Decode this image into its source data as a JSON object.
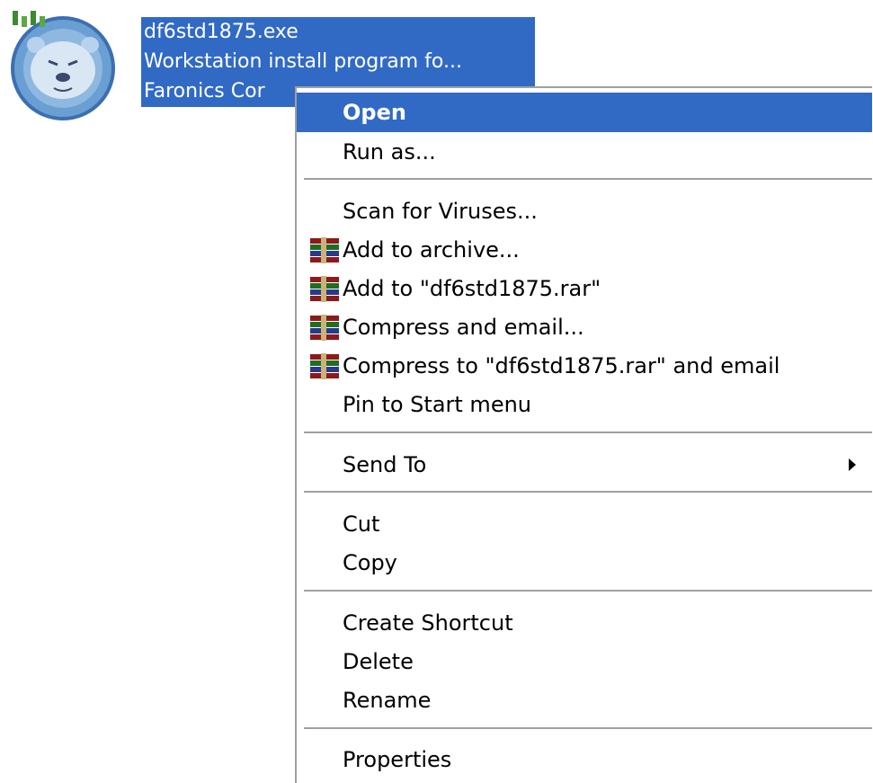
{
  "file": {
    "name": "df6std1875.exe",
    "description": "Workstation install program fo...",
    "company": "Faronics Cor"
  },
  "colors": {
    "selection": "#316ac5",
    "menu_background": "#ffffff",
    "separator": "#a0a0a0",
    "icon_bg": "#6a9fd4"
  },
  "menu": {
    "open": "Open",
    "run_as": "Run as...",
    "scan": "Scan for Viruses...",
    "add_archive": "Add to archive...",
    "add_rar": "Add to \"df6std1875.rar\"",
    "compress_email": "Compress and email...",
    "compress_rar_email": "Compress to \"df6std1875.rar\" and email",
    "pin_start": "Pin to Start menu",
    "send_to": "Send To",
    "cut": "Cut",
    "copy": "Copy",
    "create_shortcut": "Create Shortcut",
    "delete": "Delete",
    "rename": "Rename",
    "properties": "Properties"
  },
  "icons": {
    "app": "deep-freeze-bear-icon",
    "archive": "winrar-books-icon",
    "submenu": "triangle-right-icon"
  }
}
